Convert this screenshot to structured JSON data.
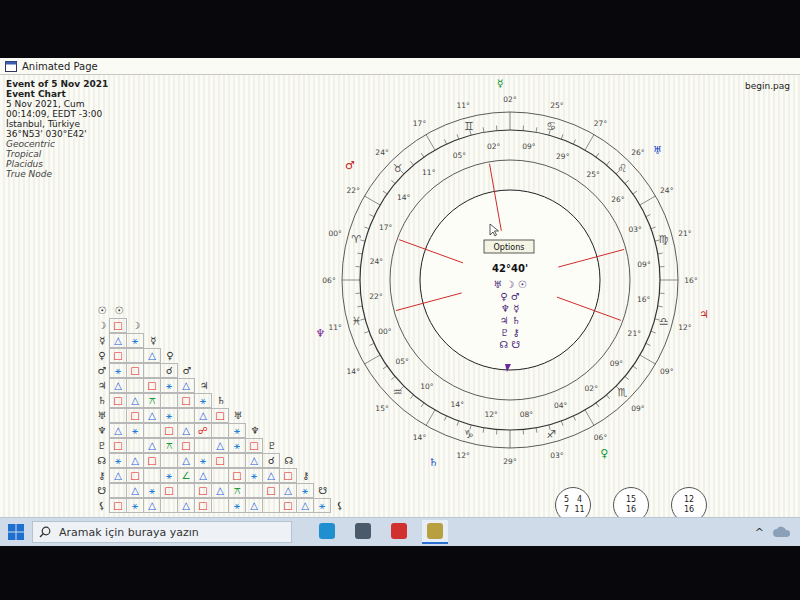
{
  "window": {
    "title": "Animated Page",
    "file": "begin.pag"
  },
  "chart_info": [
    {
      "text": "Event of 5 Nov 2021",
      "kind": "bold"
    },
    {
      "text": "Event Chart",
      "kind": "bold"
    },
    {
      "text": "5 Nov 2021, Cum",
      "kind": "normal"
    },
    {
      "text": "00:14:09, EEDT -3:00",
      "kind": "normal"
    },
    {
      "text": "İstanbul, Türkiye",
      "kind": "normal"
    },
    {
      "text": "36°N53' 030°E42'",
      "kind": "normal"
    },
    {
      "text": "Geocentric",
      "kind": "italic"
    },
    {
      "text": "Tropical",
      "kind": "italic"
    },
    {
      "text": "Placidus",
      "kind": "italic"
    },
    {
      "text": "True Node",
      "kind": "italic"
    }
  ],
  "wheel": {
    "center_reading": "42°40'",
    "tooltip": "Options",
    "center_glyphs": [
      "♅ ☽ ☉",
      "♀ ♂",
      "♆ ☿",
      "♃ ♄",
      "♇ ⚷",
      "☊ ☋"
    ],
    "signs": [
      "♈",
      "♉",
      "♊",
      "♋",
      "♌",
      "♍",
      "♎",
      "♏",
      "♐",
      "♑",
      "♒",
      "♓"
    ],
    "outer_degrees": [
      "02°",
      "25°",
      "27°",
      "26°",
      "24°",
      "21°",
      "16°",
      "12°",
      "09°",
      "09°",
      "06°",
      "03°",
      "29°",
      "12°",
      "14°",
      "15°",
      "14°",
      "11°",
      "06°",
      "00°",
      "22°",
      "24°",
      "17°",
      "11°"
    ],
    "inner_degrees": [
      "09°",
      "29°",
      "25°",
      "26°",
      "03°",
      "09°",
      "16°",
      "21°",
      "09°",
      "02°",
      "04°",
      "08°",
      "12°",
      "14°",
      "10°",
      "05°",
      "00°",
      "22°",
      "24°",
      "17°",
      "14°",
      "11°",
      "05°",
      "02°"
    ],
    "outer_bodies": [
      {
        "glyph": "♃",
        "color": "#c02020"
      },
      {
        "glyph": "♀",
        "color": "#1a9a3a"
      },
      {
        "glyph": "♄",
        "color": "#2a4fd0"
      },
      {
        "glyph": "♆",
        "color": "#7a2a9a"
      },
      {
        "glyph": "♂",
        "color": "#c02020"
      },
      {
        "glyph": "☿",
        "color": "#1a9a3a"
      },
      {
        "glyph": "♅",
        "color": "#2a4fd0"
      }
    ]
  },
  "aspect_grid": {
    "glyph_colors": {
      "△": "#1f5fe0",
      "□": "#e02020",
      "⚹": "#1f7fd8",
      "☍": "#e02020",
      "☌": "#222222",
      "⚻": "#1a9a3a",
      "∠": "#1a9a3a"
    },
    "row_labels": [
      "☉",
      "☽",
      "☿",
      "♀",
      "♂",
      "♃",
      "♄",
      "♅",
      "♆",
      "♇",
      "☊",
      "⚷",
      "☋",
      "⚸"
    ],
    "diagonal_labels": [
      "☉",
      "☽",
      "☿",
      "♀",
      "♂",
      "♃",
      "♄",
      "♅",
      "♆",
      "♇",
      "☊",
      "⚷",
      "☋",
      "⚸"
    ],
    "rows": [
      [],
      [
        "□"
      ],
      [
        "△",
        "⚹"
      ],
      [
        "□",
        "",
        "△"
      ],
      [
        "⚹",
        "□",
        "",
        "☌"
      ],
      [
        "△",
        "",
        "□",
        "⚹",
        "△"
      ],
      [
        "□",
        "△",
        "⚻",
        "",
        "□",
        "⚹"
      ],
      [
        "",
        "□",
        "△",
        "⚹",
        "",
        "△",
        "□"
      ],
      [
        "△",
        "⚹",
        "",
        "□",
        "△",
        "☍",
        "",
        "⚹"
      ],
      [
        "□",
        "",
        "△",
        "⚻",
        "□",
        "",
        "△",
        "⚹",
        "□"
      ],
      [
        "⚹",
        "△",
        "□",
        "",
        "△",
        "⚹",
        "□",
        "",
        "△",
        "☌"
      ],
      [
        "△",
        "□",
        "",
        "⚹",
        "∠",
        "△",
        "",
        "□",
        "⚹",
        "△",
        "□"
      ],
      [
        "",
        "△",
        "⚹",
        "□",
        "",
        "□",
        "△",
        "⚻",
        "",
        "□",
        "△",
        "⚹"
      ],
      [
        "□",
        "⚹",
        "△",
        "",
        "△",
        "□",
        "",
        "⚹",
        "△",
        "",
        "□",
        "△",
        "⚹"
      ]
    ]
  },
  "view_buttons": [
    {
      "labels": [
        "5",
        "4",
        "7",
        "11"
      ]
    },
    {
      "labels": [
        "15",
        "16"
      ]
    },
    {
      "labels": [
        "12",
        "16"
      ]
    }
  ],
  "taskbar": {
    "search_placeholder": "Aramak için buraya yazın",
    "apps": [
      {
        "color": "#1f8fd0",
        "active": false
      },
      {
        "color": "#4a5a6a",
        "active": false
      },
      {
        "color": "#d03030",
        "active": false
      },
      {
        "color": "#b8a040",
        "active": true
      }
    ],
    "tray_arrow": "^"
  }
}
